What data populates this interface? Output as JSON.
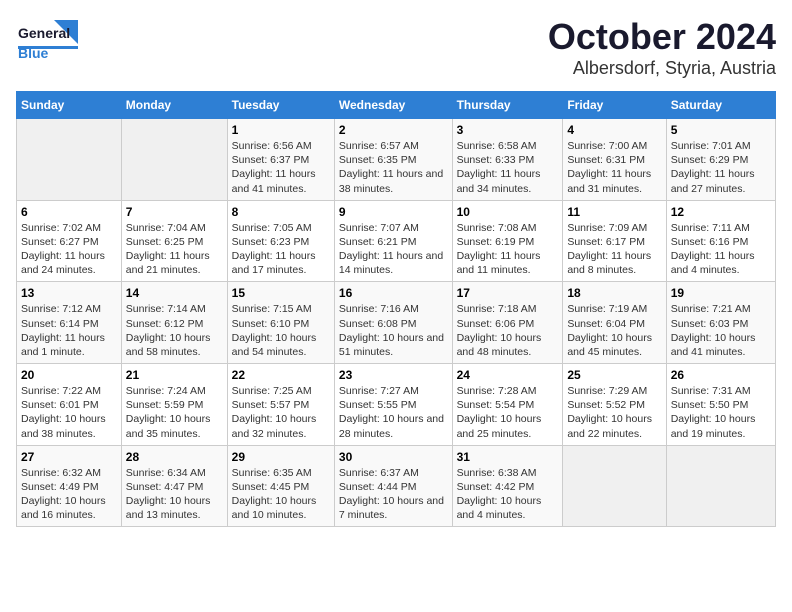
{
  "header": {
    "logo_line1": "General",
    "logo_line2": "Blue",
    "title": "October 2024",
    "subtitle": "Albersdorf, Styria, Austria"
  },
  "weekdays": [
    "Sunday",
    "Monday",
    "Tuesday",
    "Wednesday",
    "Thursday",
    "Friday",
    "Saturday"
  ],
  "weeks": [
    [
      {
        "day": "",
        "info": ""
      },
      {
        "day": "",
        "info": ""
      },
      {
        "day": "1",
        "info": "Sunrise: 6:56 AM\nSunset: 6:37 PM\nDaylight: 11 hours and 41 minutes."
      },
      {
        "day": "2",
        "info": "Sunrise: 6:57 AM\nSunset: 6:35 PM\nDaylight: 11 hours and 38 minutes."
      },
      {
        "day": "3",
        "info": "Sunrise: 6:58 AM\nSunset: 6:33 PM\nDaylight: 11 hours and 34 minutes."
      },
      {
        "day": "4",
        "info": "Sunrise: 7:00 AM\nSunset: 6:31 PM\nDaylight: 11 hours and 31 minutes."
      },
      {
        "day": "5",
        "info": "Sunrise: 7:01 AM\nSunset: 6:29 PM\nDaylight: 11 hours and 27 minutes."
      }
    ],
    [
      {
        "day": "6",
        "info": "Sunrise: 7:02 AM\nSunset: 6:27 PM\nDaylight: 11 hours and 24 minutes."
      },
      {
        "day": "7",
        "info": "Sunrise: 7:04 AM\nSunset: 6:25 PM\nDaylight: 11 hours and 21 minutes."
      },
      {
        "day": "8",
        "info": "Sunrise: 7:05 AM\nSunset: 6:23 PM\nDaylight: 11 hours and 17 minutes."
      },
      {
        "day": "9",
        "info": "Sunrise: 7:07 AM\nSunset: 6:21 PM\nDaylight: 11 hours and 14 minutes."
      },
      {
        "day": "10",
        "info": "Sunrise: 7:08 AM\nSunset: 6:19 PM\nDaylight: 11 hours and 11 minutes."
      },
      {
        "day": "11",
        "info": "Sunrise: 7:09 AM\nSunset: 6:17 PM\nDaylight: 11 hours and 8 minutes."
      },
      {
        "day": "12",
        "info": "Sunrise: 7:11 AM\nSunset: 6:16 PM\nDaylight: 11 hours and 4 minutes."
      }
    ],
    [
      {
        "day": "13",
        "info": "Sunrise: 7:12 AM\nSunset: 6:14 PM\nDaylight: 11 hours and 1 minute."
      },
      {
        "day": "14",
        "info": "Sunrise: 7:14 AM\nSunset: 6:12 PM\nDaylight: 10 hours and 58 minutes."
      },
      {
        "day": "15",
        "info": "Sunrise: 7:15 AM\nSunset: 6:10 PM\nDaylight: 10 hours and 54 minutes."
      },
      {
        "day": "16",
        "info": "Sunrise: 7:16 AM\nSunset: 6:08 PM\nDaylight: 10 hours and 51 minutes."
      },
      {
        "day": "17",
        "info": "Sunrise: 7:18 AM\nSunset: 6:06 PM\nDaylight: 10 hours and 48 minutes."
      },
      {
        "day": "18",
        "info": "Sunrise: 7:19 AM\nSunset: 6:04 PM\nDaylight: 10 hours and 45 minutes."
      },
      {
        "day": "19",
        "info": "Sunrise: 7:21 AM\nSunset: 6:03 PM\nDaylight: 10 hours and 41 minutes."
      }
    ],
    [
      {
        "day": "20",
        "info": "Sunrise: 7:22 AM\nSunset: 6:01 PM\nDaylight: 10 hours and 38 minutes."
      },
      {
        "day": "21",
        "info": "Sunrise: 7:24 AM\nSunset: 5:59 PM\nDaylight: 10 hours and 35 minutes."
      },
      {
        "day": "22",
        "info": "Sunrise: 7:25 AM\nSunset: 5:57 PM\nDaylight: 10 hours and 32 minutes."
      },
      {
        "day": "23",
        "info": "Sunrise: 7:27 AM\nSunset: 5:55 PM\nDaylight: 10 hours and 28 minutes."
      },
      {
        "day": "24",
        "info": "Sunrise: 7:28 AM\nSunset: 5:54 PM\nDaylight: 10 hours and 25 minutes."
      },
      {
        "day": "25",
        "info": "Sunrise: 7:29 AM\nSunset: 5:52 PM\nDaylight: 10 hours and 22 minutes."
      },
      {
        "day": "26",
        "info": "Sunrise: 7:31 AM\nSunset: 5:50 PM\nDaylight: 10 hours and 19 minutes."
      }
    ],
    [
      {
        "day": "27",
        "info": "Sunrise: 6:32 AM\nSunset: 4:49 PM\nDaylight: 10 hours and 16 minutes."
      },
      {
        "day": "28",
        "info": "Sunrise: 6:34 AM\nSunset: 4:47 PM\nDaylight: 10 hours and 13 minutes."
      },
      {
        "day": "29",
        "info": "Sunrise: 6:35 AM\nSunset: 4:45 PM\nDaylight: 10 hours and 10 minutes."
      },
      {
        "day": "30",
        "info": "Sunrise: 6:37 AM\nSunset: 4:44 PM\nDaylight: 10 hours and 7 minutes."
      },
      {
        "day": "31",
        "info": "Sunrise: 6:38 AM\nSunset: 4:42 PM\nDaylight: 10 hours and 4 minutes."
      },
      {
        "day": "",
        "info": ""
      },
      {
        "day": "",
        "info": ""
      }
    ]
  ]
}
